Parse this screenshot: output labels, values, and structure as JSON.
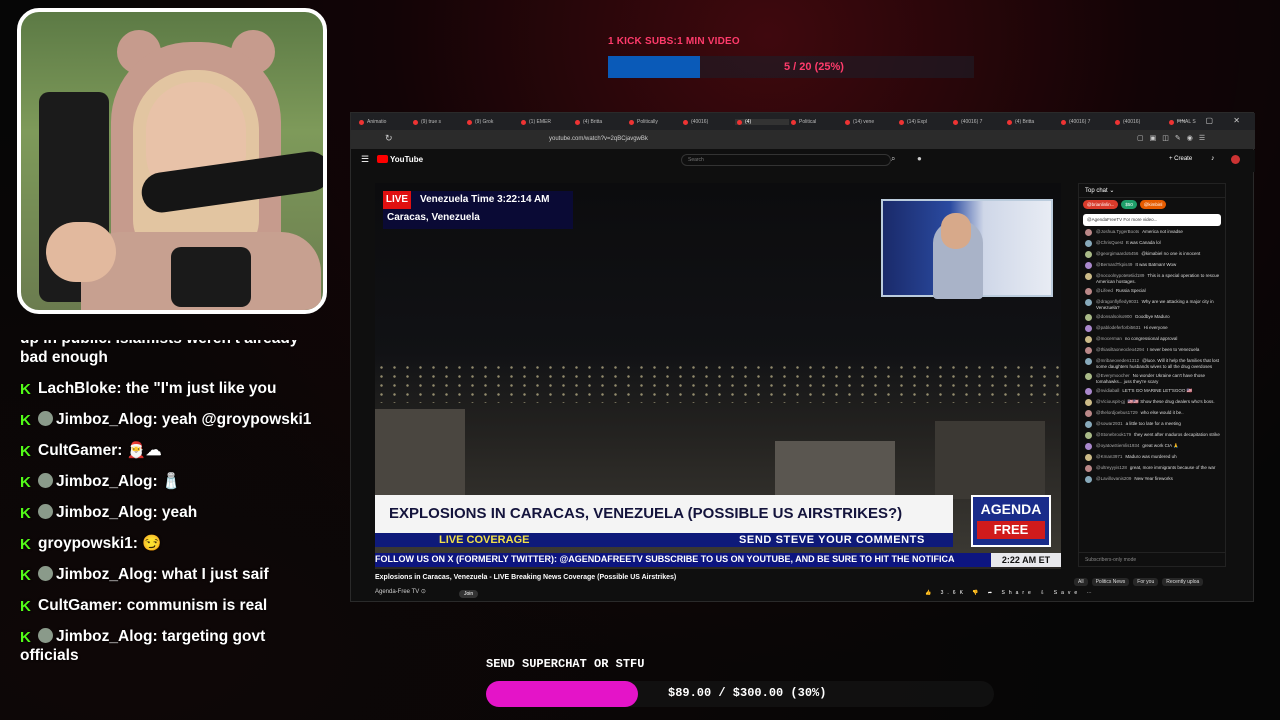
{
  "stream_overlay": {
    "kick_goal": {
      "label": "1 KICK SUBS:1 MIN VIDEO",
      "progress_text": "5 / 20 (25%)",
      "progress_fraction": 0.25,
      "fill_color": "#0a5ab8"
    },
    "superchat_goal": {
      "label": "SEND SUPERCHAT OR STFU",
      "progress_text": "$89.00 / $300.00 (30%)",
      "progress_fraction": 0.3,
      "fill_color": "#e414c8"
    }
  },
  "stream_chat": [
    {
      "user": "",
      "text": "up in public. Islamists weren't already bad enough",
      "badge": "none",
      "cut": true
    },
    {
      "user": "LachBloke",
      "text": "the \"I'm just like you",
      "badge": "kick"
    },
    {
      "user": "Jimboz_Alog",
      "text": "yeah @groypowski1",
      "badge": "kick-sub"
    },
    {
      "user": "CultGamer",
      "text": "🎅☁",
      "badge": "kick"
    },
    {
      "user": "Jimboz_Alog",
      "text": "🧂",
      "badge": "kick-sub"
    },
    {
      "user": "Jimboz_Alog",
      "text": "yeah",
      "badge": "kick-sub"
    },
    {
      "user": "groypowski1",
      "text": "😏",
      "badge": "kick"
    },
    {
      "user": "Jimboz_Alog",
      "text": "what I just saif",
      "badge": "kick-sub"
    },
    {
      "user": "CultGamer",
      "text": "communism is real",
      "badge": "kick"
    },
    {
      "user": "Jimboz_Alog",
      "text": "targeting govt officials",
      "badge": "kick-sub"
    }
  ],
  "browser": {
    "tabs": [
      "Animatio",
      "(9) true s",
      "(9) Grok",
      "(1) EMER",
      "(4) Britta",
      "Politically",
      "(40016)",
      "(4)",
      "Political",
      "(14) vene",
      "(14) Expl",
      "(40016) 7",
      "(4) Britta",
      "(40016) 7",
      "(40016)",
      "FINAL S"
    ],
    "active_tab_index": 7,
    "url": "youtube.com/watch?v=2qBCjavgwBk",
    "window_controls": "— ▢ ✕"
  },
  "youtube": {
    "logo": "YouTube",
    "search_placeholder": "Search",
    "create_label": "+ Create",
    "video_title": "Explosions in Caracas, Venezuela - LIVE Breaking News Coverage (Possible US Airstrikes)",
    "channel": "Agenda-Free TV ⊙",
    "join_label": "Join",
    "actions": "👍 3.6K 👎 ➦ Share ⇩ Save ⋯",
    "filters": [
      "All",
      "Politics News",
      "For you",
      "Recently uploa"
    ]
  },
  "broadcast": {
    "live_tag": "LIVE",
    "venezuela_time": "Venezuela Time 3:22:14 AM",
    "location": "Caracas, Venezuela",
    "lower_third_title": "EXPLOSIONS IN CARACAS, VENEZUELA (POSSIBLE US AIRSTRIKES?)",
    "coverage_label": "LIVE COVERAGE",
    "comments_label": "SEND STEVE YOUR COMMENTS",
    "brand_top": "AGENDA",
    "brand_bottom": "FREE",
    "ticker": "FOLLOW US ON X (FORMERLY TWITTER): @AGENDAFREETV     SUBSCRIBE TO US ON YOUTUBE, AND BE SURE TO HIT THE NOTIFICA",
    "ticker_time": "2:22 AM ET"
  },
  "live_chat": {
    "header": "Top chat ⌄",
    "pins": [
      {
        "text": "@brianlinlin...",
        "color": "#d93b2b"
      },
      {
        "text": "$50",
        "color": "#1e9e6a"
      },
      {
        "text": "@kimbinl",
        "color": "#e65c00"
      }
    ],
    "banner": "@AgendaFreeTV   For more video...",
    "messages": [
      {
        "user": "@Joshua.TygerBoots",
        "text": "America not invadse"
      },
      {
        "user": "@ChrisQuest",
        "text": "It was Canada lol"
      },
      {
        "user": "@georgimaardo5456",
        "text": "@kimabiel no one is innocent"
      },
      {
        "user": "@BernardTkpis49",
        "text": "It was Batman! Wow"
      },
      {
        "user": "@nocoolnypotetetiid189",
        "text": "This is a special operation to rescue American hostages."
      },
      {
        "user": "@Lifeed",
        "text": "Russia Special"
      },
      {
        "user": "@dragonflyfledy9031",
        "text": "Why are we attacking a major city in Venezuela?"
      },
      {
        "user": "@donsalsolso900",
        "text": "Goodbye Maduro"
      },
      {
        "user": "@pablodeferforbi5631",
        "text": "Hi everyone"
      },
      {
        "user": "@mocerman",
        "text": "no congressional approval"
      },
      {
        "user": "@thiasiltaoneocleo4294",
        "text": "I never been to Venezuela"
      },
      {
        "user": "@mribaeoveden1312",
        "text": "@luce. Will it help the families that lost some daughters husbands wives to all the drug overdoses"
      },
      {
        "user": "@Everymoocher",
        "text": "No wonder Ukraine can't have those tomahawks... juss they're scary"
      },
      {
        "user": "@nvidiaball",
        "text": "LET'S GO MARINE LET'SGOO 🇺🇸"
      },
      {
        "user": "@Viciouspit-gj",
        "text": "🇺🇸🇺🇸 Show these drug dealers who's boss."
      },
      {
        "user": "@thelordjoebus1729",
        "text": "who else would it be.."
      },
      {
        "user": "@sowar2931",
        "text": "a little too late for a meeting"
      },
      {
        "user": "@Stonebrook179",
        "text": "they went after maduros decapitation strike"
      },
      {
        "user": "@oyatowSiemlis1934",
        "text": "great work CIA 🙏"
      },
      {
        "user": "@Kman3971",
        "text": "Maduro was murdered uh"
      },
      {
        "user": "@ultreyyyis128",
        "text": "great, more immigrants because of the war"
      },
      {
        "user": "@Lavillovanis209",
        "text": "New Year fireworks"
      }
    ],
    "footer": "Subscribers-only mode"
  }
}
